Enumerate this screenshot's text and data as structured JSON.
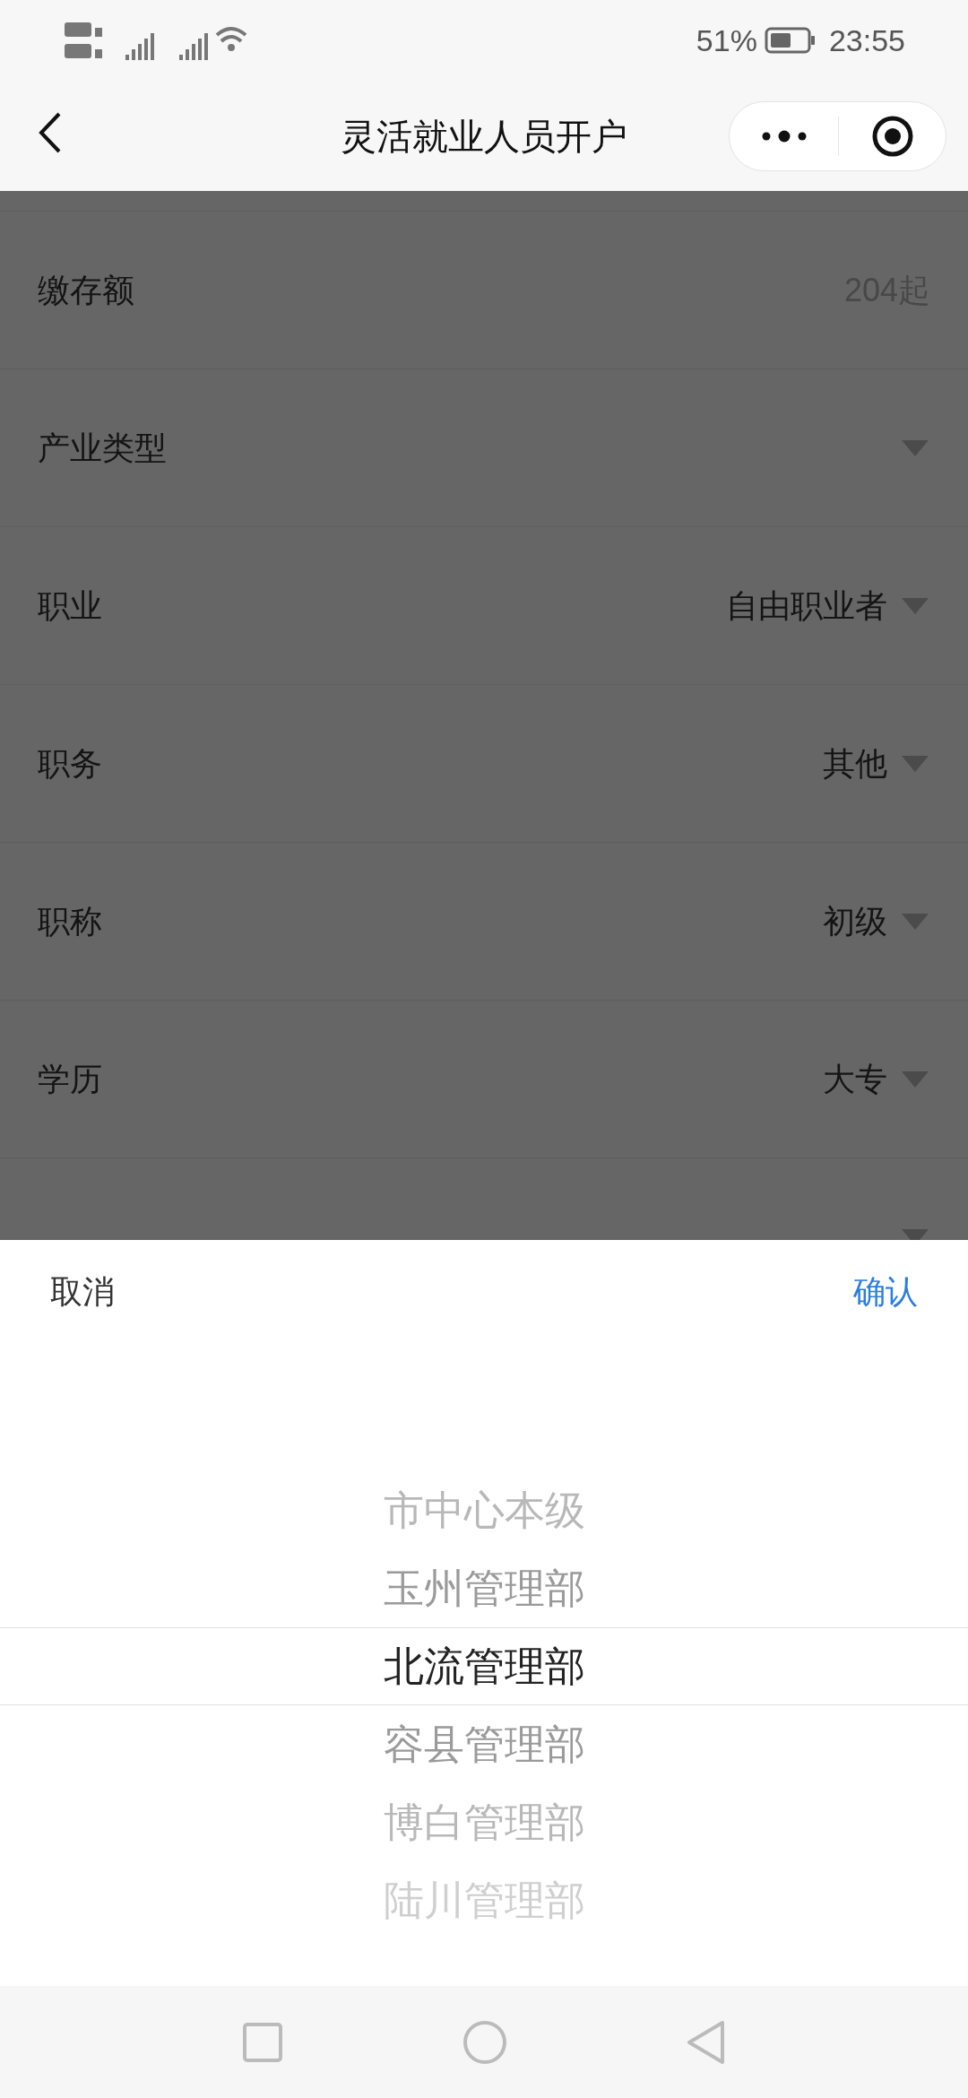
{
  "status_bar": {
    "battery": "51%",
    "time": "23:55"
  },
  "nav": {
    "title": "灵活就业人员开户"
  },
  "form": {
    "rows": [
      {
        "label": "缴存额",
        "kind": "amount",
        "value": "204起"
      },
      {
        "label": "产业类型",
        "kind": "dropdown"
      },
      {
        "label": "职业",
        "kind": "dropdown",
        "value": "自由职业者"
      },
      {
        "label": "职务",
        "kind": "dropdown",
        "value": "其他"
      },
      {
        "label": "职称",
        "kind": "dropdown",
        "value": "初级"
      },
      {
        "label": "学历",
        "kind": "dropdown",
        "value": "大专"
      },
      {
        "kind": "dropdown"
      }
    ]
  },
  "picker": {
    "cancel": "取消",
    "confirm": "确认",
    "options": [
      {
        "label": "市中心本级",
        "selected": false
      },
      {
        "label": "玉州管理部",
        "selected": false
      },
      {
        "label": "北流管理部",
        "selected": true
      },
      {
        "label": "容县管理部",
        "selected": false
      },
      {
        "label": "博白管理部",
        "selected": false
      },
      {
        "label": "陆川管理部",
        "selected": false
      }
    ]
  }
}
